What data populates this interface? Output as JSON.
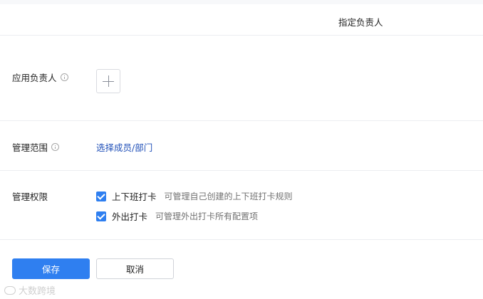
{
  "header": {
    "title": "指定负责人"
  },
  "owner": {
    "label": "应用负责人"
  },
  "scope": {
    "label": "管理范围",
    "select_link": "选择成员/部门"
  },
  "permissions": {
    "label": "管理权限",
    "items": [
      {
        "name": "上下班打卡",
        "desc": "可管理自己创建的上下班打卡规则",
        "checked": true
      },
      {
        "name": "外出打卡",
        "desc": "可管理外出打卡所有配置项",
        "checked": true
      }
    ]
  },
  "actions": {
    "save": "保存",
    "cancel": "取消"
  },
  "watermark": {
    "text": "大数跨境"
  },
  "colors": {
    "primary": "#2f7ff0",
    "link": "#1f4fb8",
    "divider": "#eceef1"
  },
  "icons": {
    "info": "info-circle-icon",
    "add": "plus-icon",
    "check": "check-icon"
  }
}
